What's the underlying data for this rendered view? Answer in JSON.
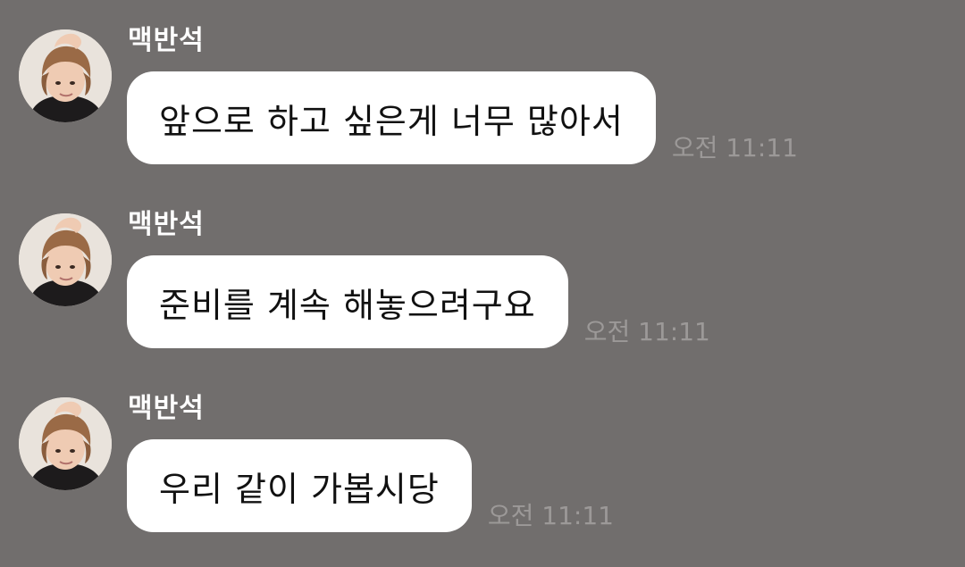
{
  "chat": {
    "messages": [
      {
        "sender": "맥반석",
        "text": "앞으로 하고 싶은게 너무 많아서",
        "time": "오전 11:11"
      },
      {
        "sender": "맥반석",
        "text": "준비를 계속 해놓으려구요",
        "time": "오전 11:11"
      },
      {
        "sender": "맥반석",
        "text": "우리 같이 가봅시당",
        "time": "오전 11:11"
      }
    ]
  },
  "colors": {
    "background": "#716e6d",
    "bubble": "#ffffff",
    "timestamp": "#9c9998",
    "sender_name": "#ffffff"
  }
}
